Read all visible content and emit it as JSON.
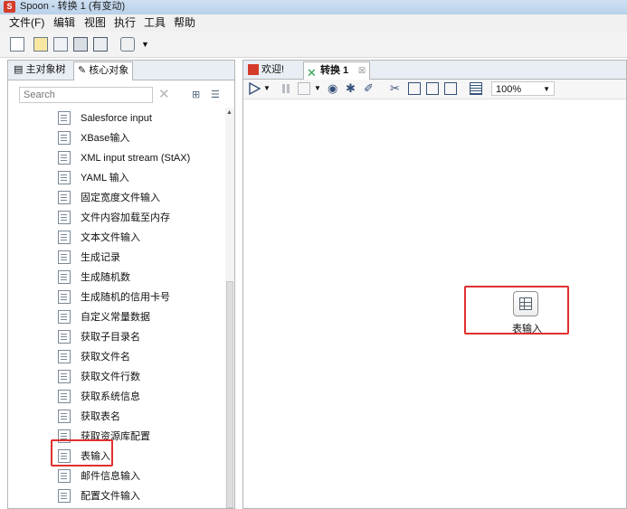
{
  "window": {
    "title": "Spoon - 转换 1 (有变动)"
  },
  "menu": [
    "文件(F)",
    "编辑",
    "视图",
    "执行",
    "工具",
    "帮助"
  ],
  "left_tabs": {
    "main_tree": "主对象树",
    "core_objects": "核心对象"
  },
  "search": {
    "placeholder": "Search"
  },
  "steps": [
    "Salesforce input",
    "XBase输入",
    "XML input stream (StAX)",
    "YAML 输入",
    "固定宽度文件输入",
    "文件内容加载至内存",
    "文本文件输入",
    "生成记录",
    "生成随机数",
    "生成随机的信用卡号",
    "自定义常量数据",
    "获取子目录名",
    "获取文件名",
    "获取文件行数",
    "获取系统信息",
    "获取表名",
    "获取资源库配置",
    "表输入",
    "邮件信息输入",
    "配置文件输入"
  ],
  "right_tabs": {
    "welcome": "欢迎!",
    "transform": "转换 1"
  },
  "zoom": "100%",
  "canvas_step": {
    "label": "表输入"
  },
  "highlight_color": "#e0302f"
}
